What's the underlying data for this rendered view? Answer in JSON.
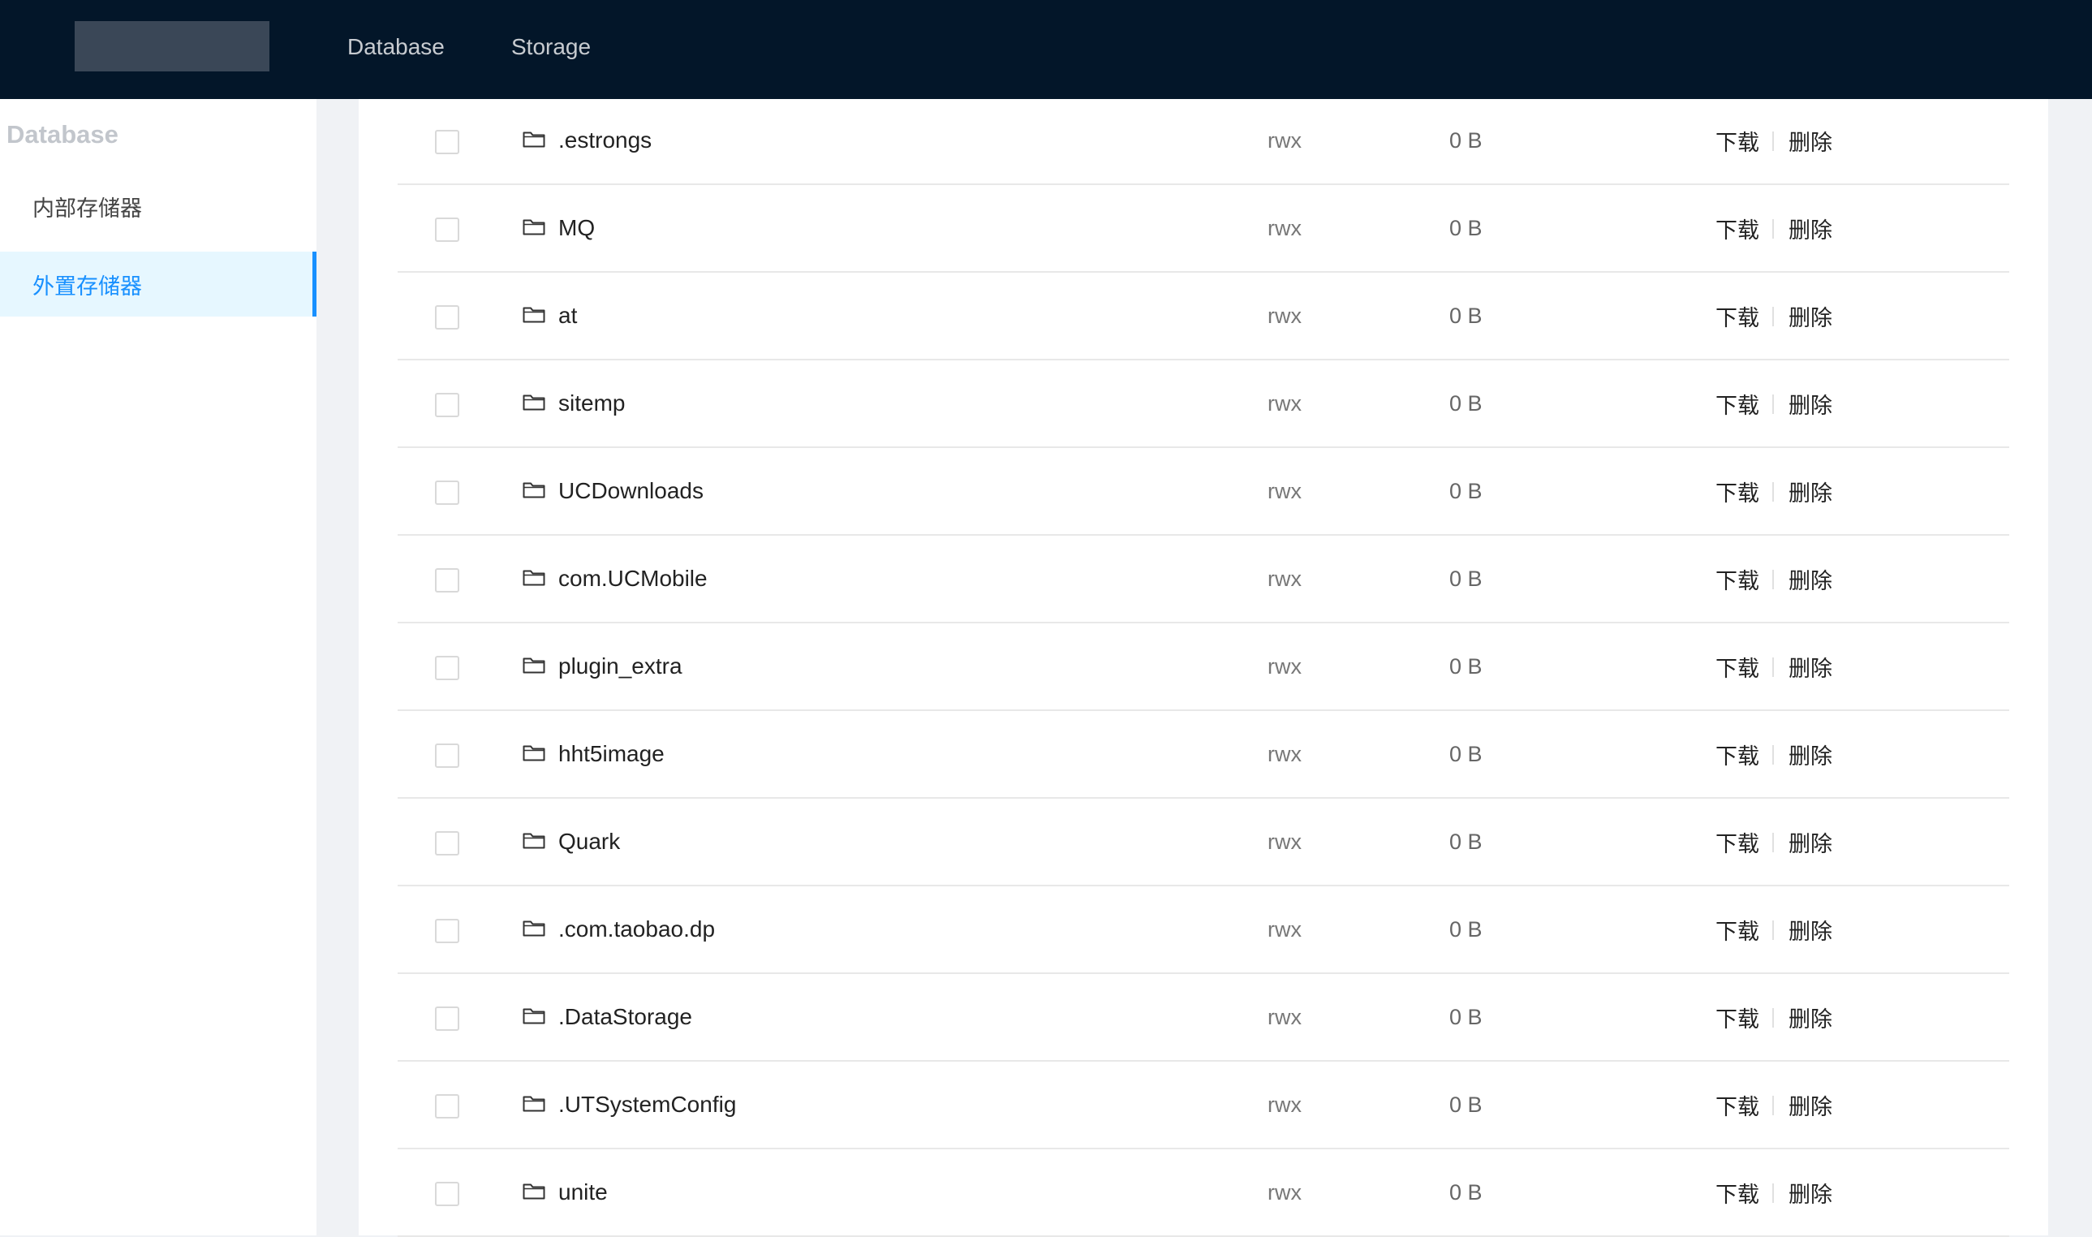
{
  "header": {
    "nav": [
      "Database",
      "Storage"
    ]
  },
  "sidebar": {
    "title": "Database",
    "items": [
      {
        "label": "内部存储器",
        "active": false
      },
      {
        "label": "外置存储器",
        "active": true
      }
    ]
  },
  "table": {
    "actions": {
      "download": "下载",
      "delete": "删除"
    },
    "rows": [
      {
        "name": ".estrongs",
        "perm": "rwx",
        "size": "0 B"
      },
      {
        "name": "MQ",
        "perm": "rwx",
        "size": "0 B"
      },
      {
        "name": "at",
        "perm": "rwx",
        "size": "0 B"
      },
      {
        "name": "sitemp",
        "perm": "rwx",
        "size": "0 B"
      },
      {
        "name": "UCDownloads",
        "perm": "rwx",
        "size": "0 B"
      },
      {
        "name": "com.UCMobile",
        "perm": "rwx",
        "size": "0 B"
      },
      {
        "name": "plugin_extra",
        "perm": "rwx",
        "size": "0 B"
      },
      {
        "name": "hht5image",
        "perm": "rwx",
        "size": "0 B"
      },
      {
        "name": "Quark",
        "perm": "rwx",
        "size": "0 B"
      },
      {
        "name": ".com.taobao.dp",
        "perm": "rwx",
        "size": "0 B"
      },
      {
        "name": ".DataStorage",
        "perm": "rwx",
        "size": "0 B"
      },
      {
        "name": ".UTSystemConfig",
        "perm": "rwx",
        "size": "0 B"
      },
      {
        "name": "unite",
        "perm": "rwx",
        "size": "0 B"
      }
    ]
  },
  "colors": {
    "header_bg": "#031629",
    "accent": "#1890ff",
    "active_bg": "#e6f7ff"
  },
  "icons": {
    "row": "folder-icon"
  }
}
